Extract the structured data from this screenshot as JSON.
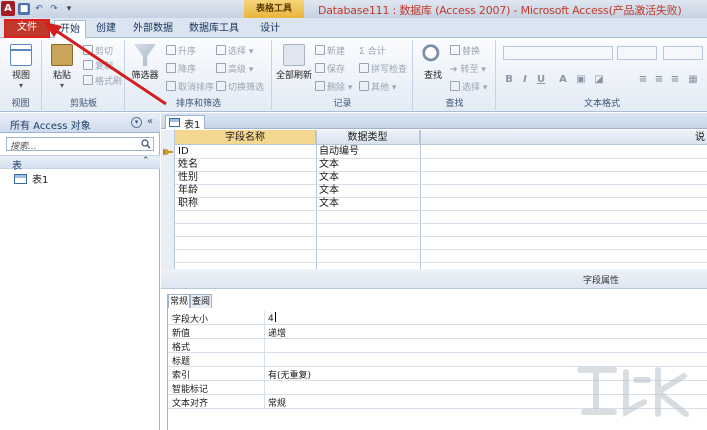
{
  "window": {
    "title": "Database111 : 数据库 (Access 2007) - Microsoft Access(产品激活失败)",
    "context_tab_header": "表格工具"
  },
  "qat": [
    "save-icon",
    "undo-icon",
    "redo-icon",
    "customize-icon"
  ],
  "tabs": [
    {
      "label": "文件"
    },
    {
      "label": "开始"
    },
    {
      "label": "创建"
    },
    {
      "label": "外部数据"
    },
    {
      "label": "数据库工具"
    },
    {
      "label": "设计"
    }
  ],
  "ribbon": {
    "view": {
      "button": "视图",
      "group": "视图"
    },
    "clipboard": {
      "paste": "粘贴",
      "cut": "剪切",
      "copy": "复制",
      "format_painter": "格式刷",
      "group": "剪贴板"
    },
    "sort_filter": {
      "filter": "筛选器",
      "ascending": "升序",
      "descending": "降序",
      "clear_sort": "取消排序",
      "selection": "选择",
      "advanced": "高级",
      "toggle_filter": "切换筛选",
      "group": "排序和筛选"
    },
    "records": {
      "refresh_all": "全部刷新",
      "new": "新建",
      "save": "保存",
      "delete": "删除",
      "totals": "合计",
      "spelling": "拼写检查",
      "more": "其他",
      "group": "记录"
    },
    "find": {
      "find": "查找",
      "replace": "替换",
      "goto": "转至",
      "select": "选择",
      "group": "查找"
    },
    "text_format": {
      "group": "文本格式"
    }
  },
  "navpane": {
    "header": "所有 Access 对象",
    "search_placeholder": "搜索...",
    "section": "表",
    "items": [
      {
        "label": "表1"
      }
    ]
  },
  "document": {
    "tab_label": "表1",
    "columns": {
      "field_name": "字段名称",
      "data_type": "数据类型",
      "description": "说"
    },
    "rows": [
      {
        "name": "ID",
        "type": "自动编号"
      },
      {
        "name": "姓名",
        "type": "文本"
      },
      {
        "name": "性别",
        "type": "文本"
      },
      {
        "name": "年龄",
        "type": "文本"
      },
      {
        "name": "职称",
        "type": "文本"
      }
    ],
    "properties_label": "字段属性",
    "property_tabs": [
      "常规",
      "查阅"
    ],
    "properties": [
      {
        "label": "字段大小",
        "value": "4"
      },
      {
        "label": "新值",
        "value": "递增"
      },
      {
        "label": "格式",
        "value": ""
      },
      {
        "label": "标题",
        "value": ""
      },
      {
        "label": "索引",
        "value": "有(无重复)"
      },
      {
        "label": "智能标记",
        "value": ""
      },
      {
        "label": "文本对齐",
        "value": "常规"
      }
    ]
  },
  "colors": {
    "file_tab": "#c0392b",
    "title_text": "#c0392b",
    "arrow": "#d11f1f",
    "context_tab": "#e9b53d",
    "selected_header": "#f5d890"
  }
}
